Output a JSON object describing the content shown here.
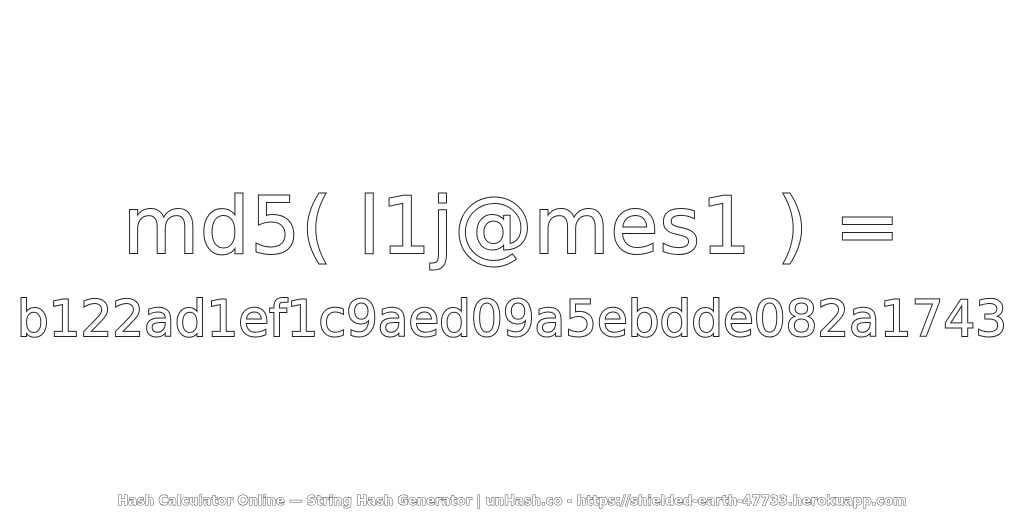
{
  "headline": "md5( l1j@mes1 ) =",
  "hash": "b122ad1ef1c9aed09a5ebdde082a1743",
  "footer": "Hash Calculator Online — String Hash Generator | unHash.co - https://shielded-earth-47733.herokuapp.com",
  "colors": {
    "background": "#ffffff",
    "text_fill": "#ffffff",
    "text_outline": "#222222"
  }
}
